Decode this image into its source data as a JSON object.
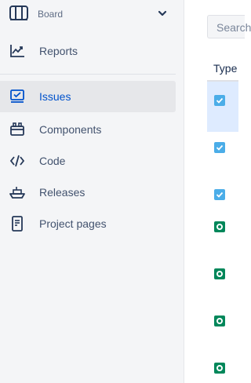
{
  "sidebar": {
    "board": {
      "label": "Board",
      "icon": "board-icon",
      "chevron": "chevron-down-icon"
    },
    "items": [
      {
        "label": "Reports",
        "icon": "reports-icon",
        "active": false
      },
      {
        "label": "Issues",
        "icon": "issues-icon",
        "active": true
      },
      {
        "label": "Components",
        "icon": "components-icon",
        "active": false
      },
      {
        "label": "Code",
        "icon": "code-icon",
        "active": false
      },
      {
        "label": "Releases",
        "icon": "releases-icon",
        "active": false
      },
      {
        "label": "Project pages",
        "icon": "project-pages-icon",
        "active": false
      }
    ]
  },
  "main": {
    "search": {
      "placeholder": "Search"
    },
    "table": {
      "columns": [
        "Type"
      ],
      "rows": [
        {
          "type": "task",
          "selected": true
        },
        {
          "type": "task",
          "selected": false
        },
        {
          "type": "task",
          "selected": false
        },
        {
          "type": "story",
          "selected": false
        },
        {
          "type": "story",
          "selected": false
        },
        {
          "type": "story",
          "selected": false
        },
        {
          "type": "story",
          "selected": false
        }
      ]
    }
  },
  "colors": {
    "accent": "#0052cc",
    "task": "#4bade8",
    "story": "#00875a",
    "sidebar_bg": "#f4f5f7",
    "selected_row": "#deebff"
  }
}
